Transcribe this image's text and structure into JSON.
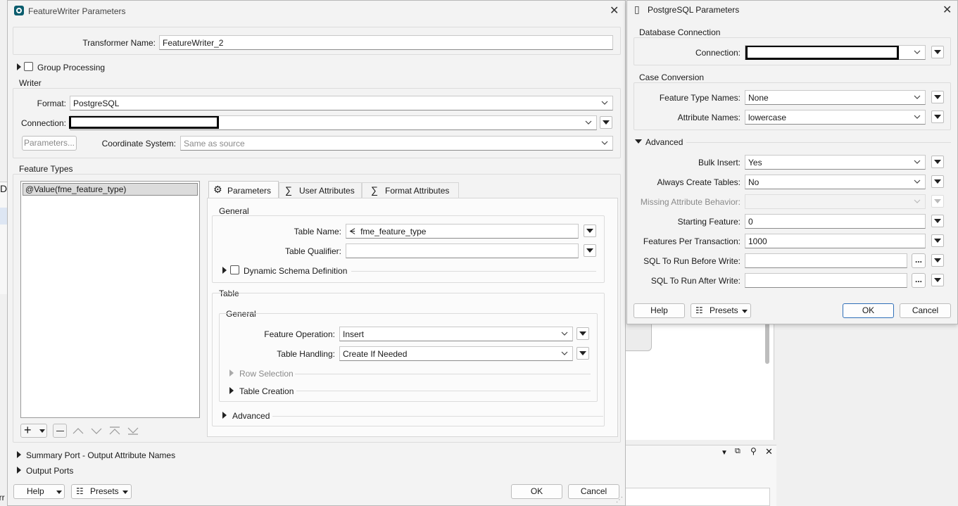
{
  "main_dialog": {
    "title": "FeatureWriter Parameters",
    "transformer_name_label": "Transformer Name:",
    "transformer_name_value": "FeatureWriter_2",
    "group_processing_label": "Group Processing",
    "writer_heading": "Writer",
    "format_label": "Format:",
    "format_value": "PostgreSQL",
    "connection_label": "Connection:",
    "parameters_button": "Parameters...",
    "coord_system_label": "Coordinate System:",
    "coord_system_value": "Same as source",
    "feature_types_heading": "Feature Types",
    "feature_type_item": "@Value(fme_feature_type)",
    "tabs": [
      {
        "label": "Parameters",
        "icon": "gear-icon",
        "active": true
      },
      {
        "label": "User Attributes",
        "icon": "sigma-icon",
        "active": false
      },
      {
        "label": "Format Attributes",
        "icon": "sigma-icon",
        "active": false
      }
    ],
    "general_heading": "General",
    "table_name_label": "Table Name:",
    "table_name_value": "fme_feature_type",
    "table_qualifier_label": "Table Qualifier:",
    "table_qualifier_value": "",
    "dynamic_schema_label": "Dynamic Schema Definition",
    "table_heading": "Table",
    "table_general_heading": "General",
    "feature_operation_label": "Feature Operation:",
    "feature_operation_value": "Insert",
    "table_handling_label": "Table Handling:",
    "table_handling_value": "Create If Needed",
    "row_selection_label": "Row Selection",
    "table_creation_label": "Table Creation",
    "advanced_label": "Advanced",
    "summary_port_label": "Summary Port - Output Attribute Names",
    "output_ports_label": "Output Ports",
    "help_button": "Help",
    "presets_button": "Presets",
    "ok_button": "OK",
    "cancel_button": "Cancel"
  },
  "pg_dialog": {
    "title": "PostgreSQL Parameters",
    "db_connection_heading": "Database Connection",
    "connection_label": "Connection:",
    "case_conversion_heading": "Case Conversion",
    "feature_type_names_label": "Feature Type Names:",
    "feature_type_names_value": "None",
    "attribute_names_label": "Attribute Names:",
    "attribute_names_value": "lowercase",
    "advanced_heading": "Advanced",
    "bulk_insert_label": "Bulk Insert:",
    "bulk_insert_value": "Yes",
    "always_create_label": "Always Create Tables:",
    "always_create_value": "No",
    "missing_attr_label": "Missing Attribute Behavior:",
    "missing_attr_value": "",
    "starting_feature_label": "Starting Feature:",
    "starting_feature_value": "0",
    "features_per_tx_label": "Features Per Transaction:",
    "features_per_tx_value": "1000",
    "sql_before_label": "SQL To Run Before Write:",
    "sql_before_value": "",
    "sql_after_label": "SQL To Run After Write:",
    "sql_after_value": "",
    "ellipsis": "...",
    "help_button": "Help",
    "presets_button": "Presets",
    "ok_button": "OK",
    "cancel_button": "Cancel"
  },
  "background": {
    "left_edge_letter": "D",
    "bottom_left_text": "orr"
  }
}
